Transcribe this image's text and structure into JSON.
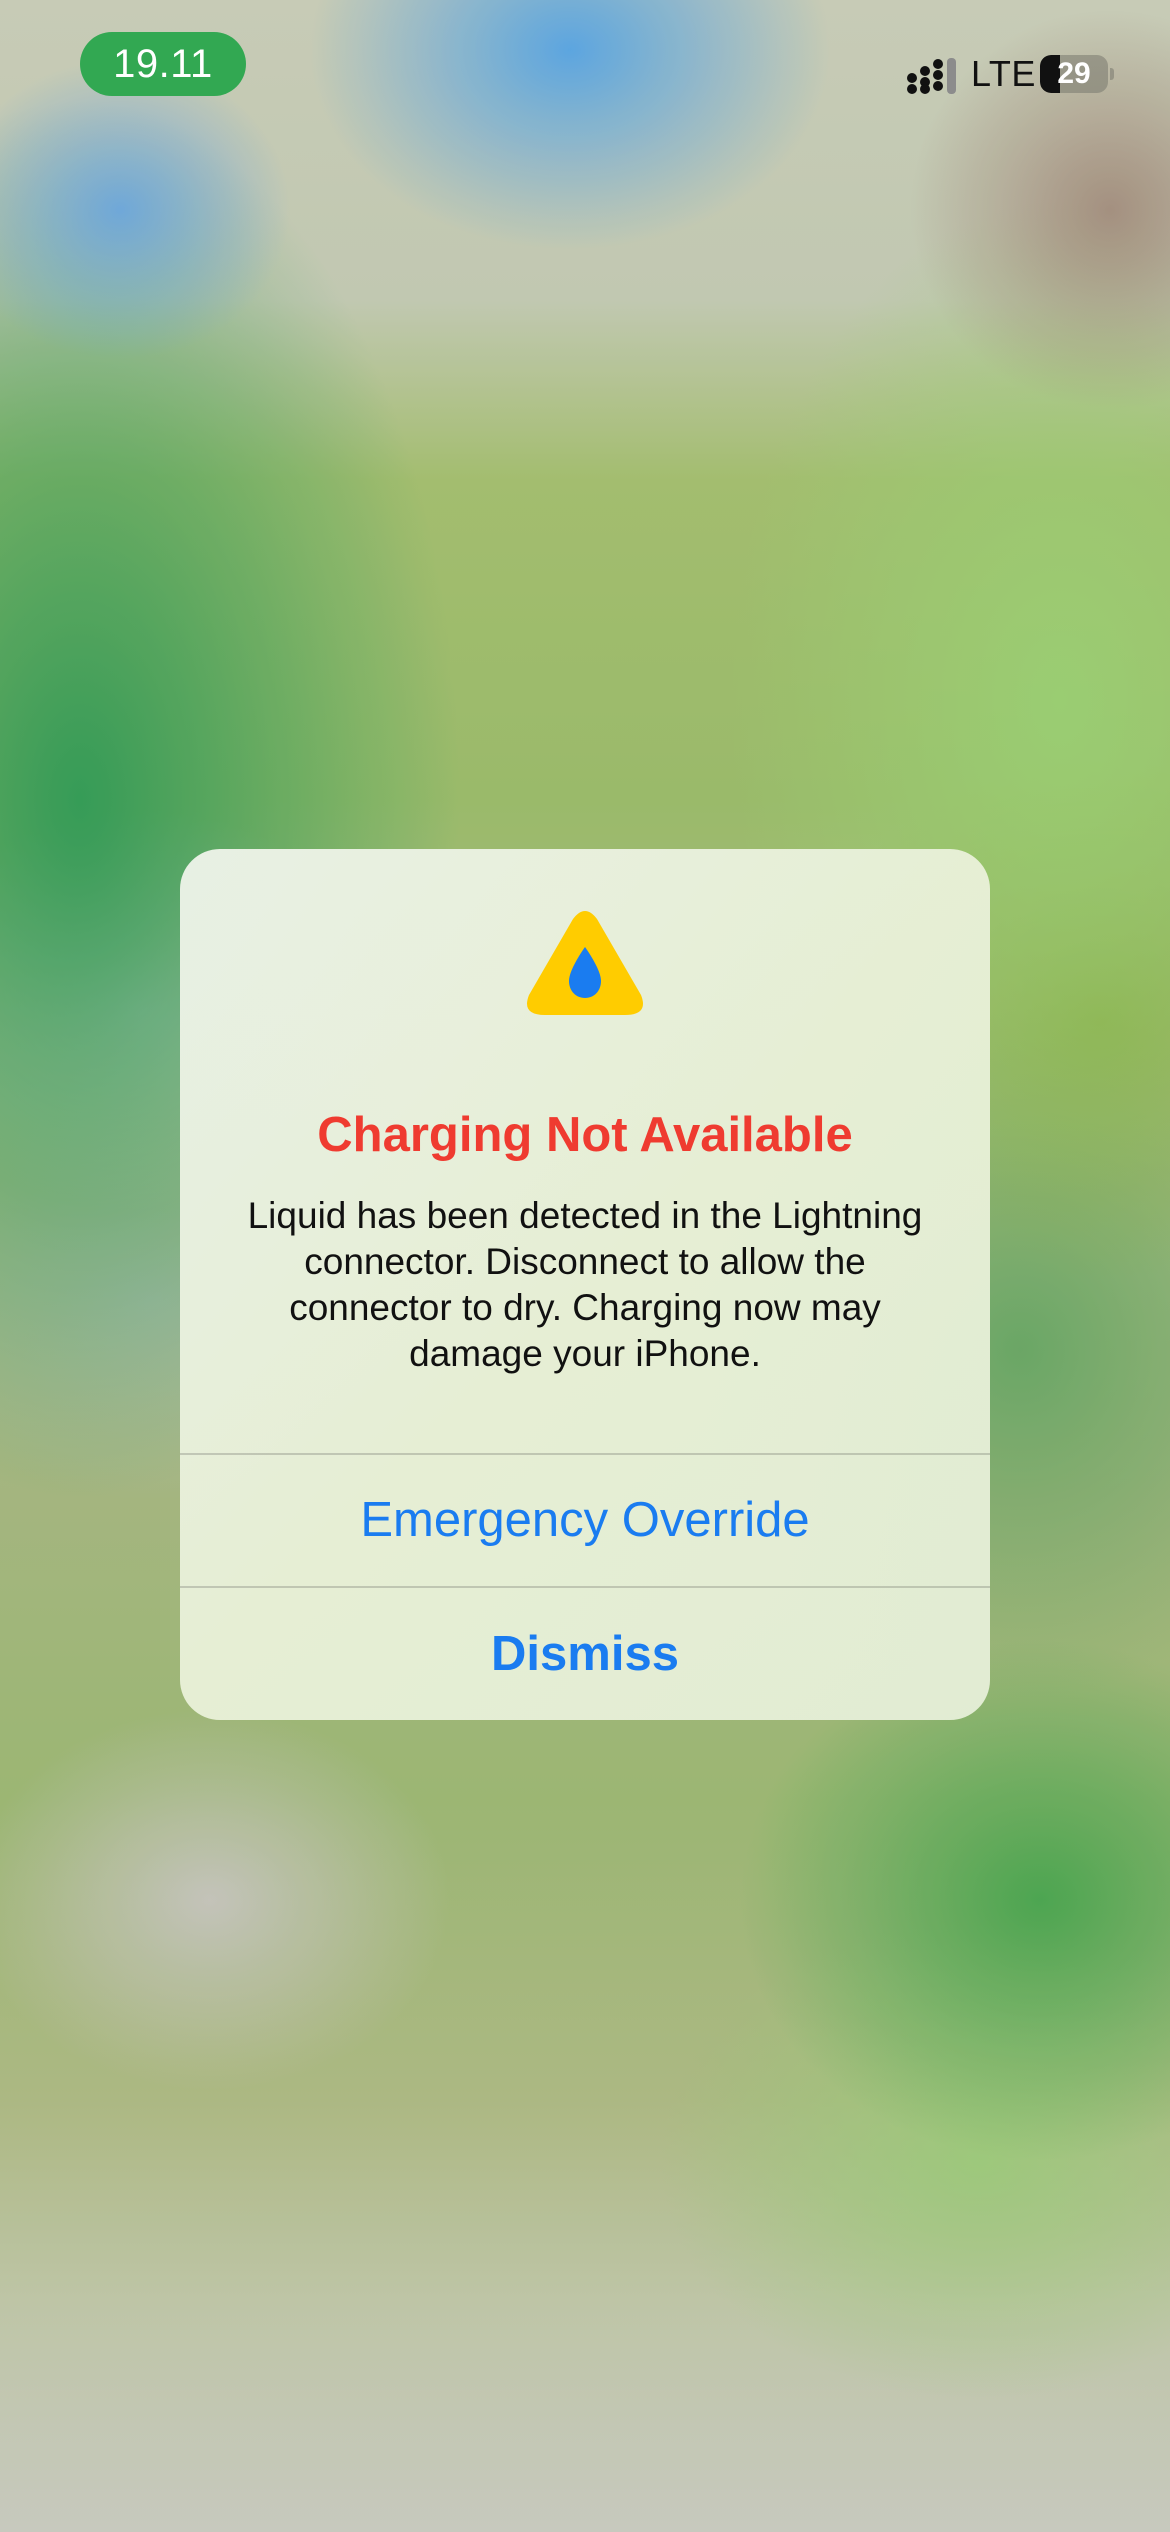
{
  "status_bar": {
    "time": "19.11",
    "network": "LTE",
    "battery_level": "29",
    "battery_fraction": 0.29,
    "signal_icon": "cellular-signal-icon",
    "battery_icon": "battery-icon",
    "time_pill_color": "#32a852"
  },
  "alert": {
    "icon": "liquid-warning-icon",
    "icon_color": "#ffcc00",
    "drop_color": "#1a7cf0",
    "title": "Charging Not Available",
    "title_color": "#ef3b30",
    "message": "Liquid has been detected in the Lightning connector. Disconnect to allow the connector to dry. Charging now may damage your iPhone.",
    "buttons": [
      {
        "label": "Emergency Override"
      },
      {
        "label": "Dismiss"
      }
    ],
    "button_color": "#1a7cf0"
  }
}
